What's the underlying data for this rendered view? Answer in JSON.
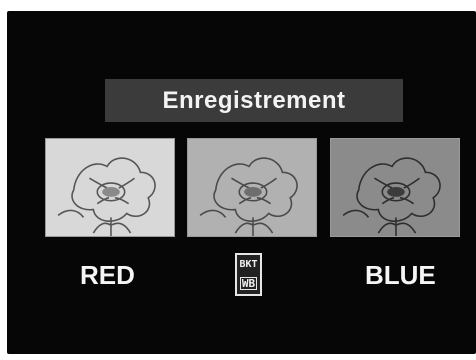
{
  "menu": {
    "title": "Enregistrement"
  },
  "bracket": {
    "labels": [
      "RED",
      "BLUE"
    ],
    "icon": {
      "name": "bkt-wb-icon",
      "line1": "BKT",
      "line2": "WB"
    },
    "previews": [
      {
        "name": "preview-red",
        "tone": "#d8d8d8"
      },
      {
        "name": "preview-normal",
        "tone": "#b1b1b1"
      },
      {
        "name": "preview-blue",
        "tone": "#8b8b8b"
      }
    ]
  }
}
